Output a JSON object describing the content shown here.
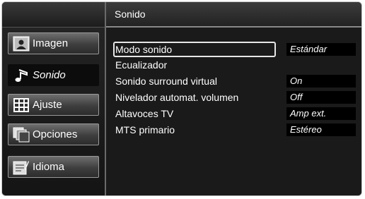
{
  "header": {
    "title": "Sonido"
  },
  "sidebar": {
    "items": [
      {
        "label": "Imagen",
        "icon": "picture-icon",
        "active": false
      },
      {
        "label": "Sonido",
        "icon": "music-note-icon",
        "active": true
      },
      {
        "label": "Ajuste",
        "icon": "grid-icon",
        "active": false
      },
      {
        "label": "Opciones",
        "icon": "layers-icon",
        "active": false
      },
      {
        "label": "Idioma",
        "icon": "language-icon",
        "active": false
      }
    ]
  },
  "settings": [
    {
      "label": "Modo sonido",
      "value": "Estándar",
      "selected": true
    },
    {
      "label": "Ecualizador",
      "value": ""
    },
    {
      "label": "Sonido surround virtual",
      "value": "On"
    },
    {
      "label": "Nivelador automat. volumen",
      "value": "Off"
    },
    {
      "label": "Altavoces TV",
      "value": "Amp ext."
    },
    {
      "label": "MTS primario",
      "value": "Estéreo"
    }
  ],
  "colors": {
    "selection_border": "#e6e6e6",
    "value_bg": "#000000",
    "panel_bg": "#1a1a1a"
  }
}
